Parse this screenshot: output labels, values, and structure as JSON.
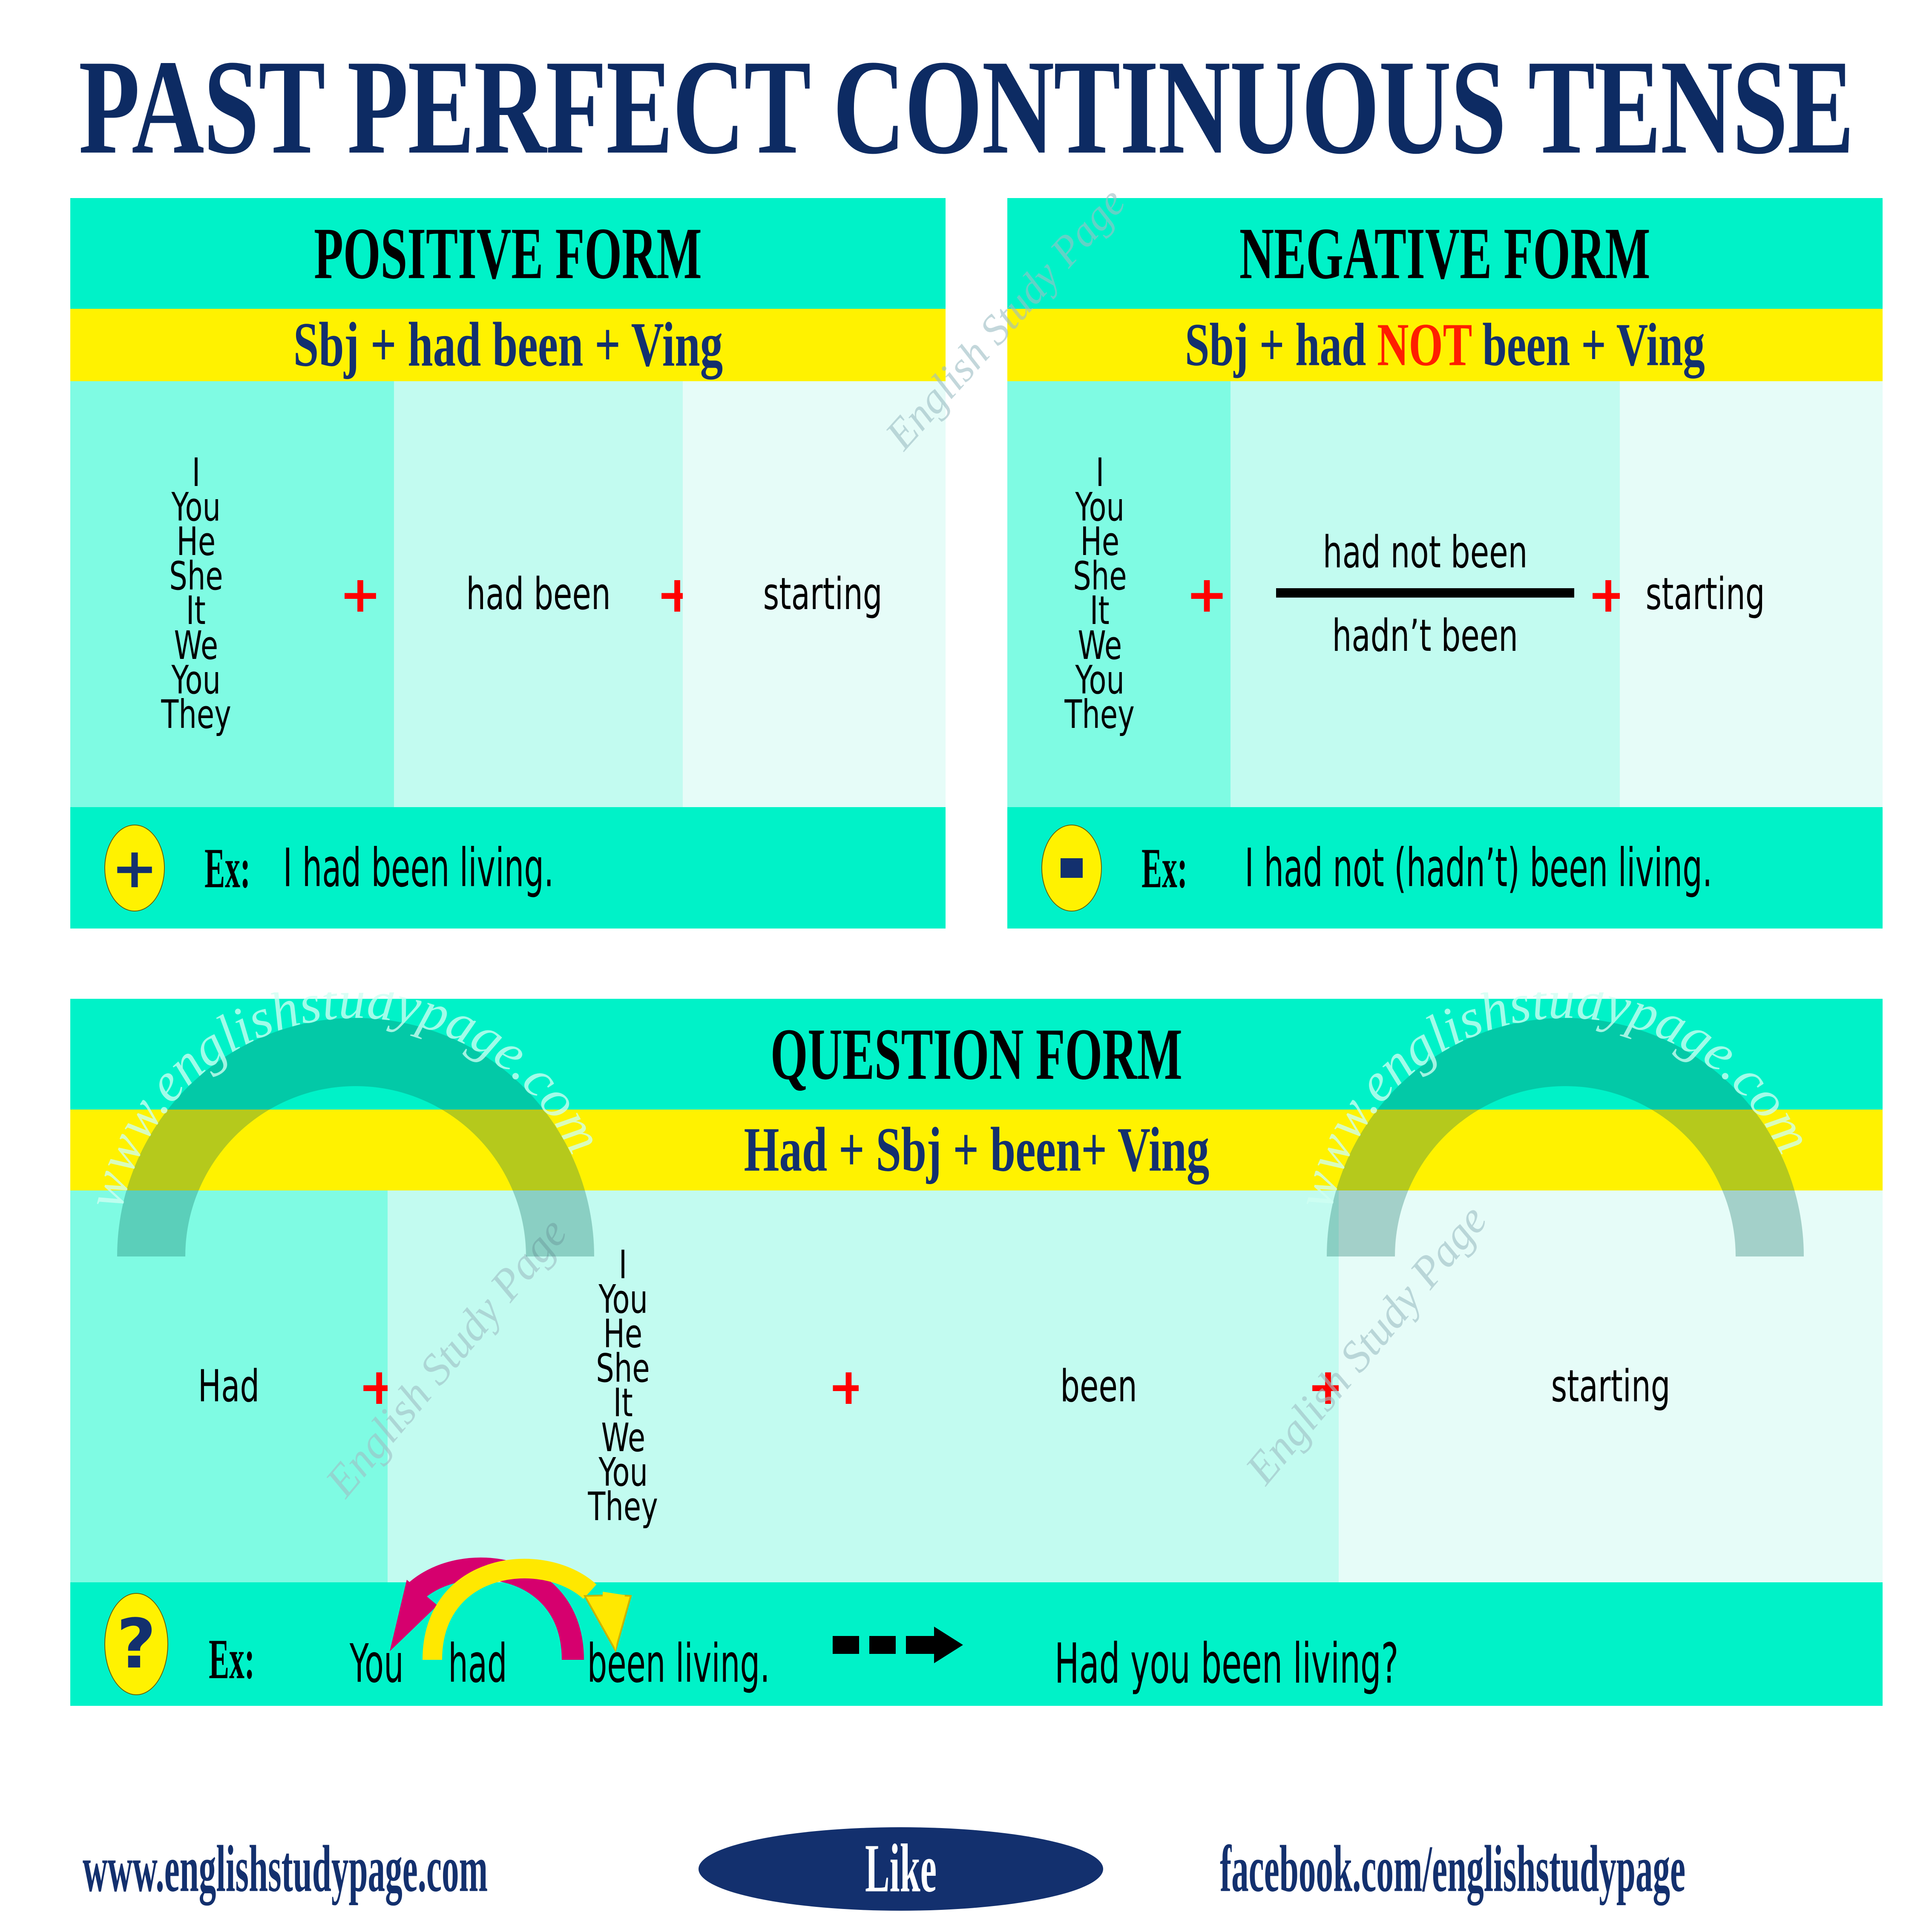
{
  "title": "PAST PERFECT CONTINUOUS TENSE",
  "colors": {
    "navy": "#13306e",
    "title_navy": "#0d2b63",
    "accent_turquoise": "#00f2c8",
    "tint_1": "#7ffbe3",
    "tint_2": "#c2fbf0",
    "tint_3": "#e6fcf8",
    "yellow": "#fff200",
    "red": "#ff0000",
    "pink_arrow": "#d6006e",
    "yellow_arrow": "#ffe800"
  },
  "pronouns": [
    "I",
    "You",
    "He",
    "She",
    "It",
    "We",
    "You",
    "They"
  ],
  "plus_sign": "+",
  "positive": {
    "heading": "POSITIVE FORM",
    "formula_prefix": "Sbj + had been + Ving",
    "col_aux": "had been",
    "col_verb": "starting",
    "example_badge": "plus-icon",
    "example_label": "Ex:",
    "example_text": "I had been living."
  },
  "negative": {
    "heading": "NEGATIVE FORM",
    "formula_a": "Sbj + had ",
    "formula_not": "NOT",
    "formula_b": " been + Ving",
    "col_long": "had not been",
    "col_short": "hadn’t been",
    "col_verb": "starting",
    "example_badge": "minus-icon",
    "example_label": "Ex:",
    "example_text": "I had not (hadn’t) been living."
  },
  "question": {
    "heading": "QUESTION FORM",
    "formula": "Had +  Sbj + been+ Ving",
    "col_had": "Had",
    "col_been": "been",
    "col_verb": "starting",
    "example_badge": "question-icon",
    "example_label": "Ex:",
    "source_you": "You",
    "source_had": "had",
    "source_rest": "been living.",
    "arrow_glyph": "dashed-arrow-icon",
    "result": "Had you been living?"
  },
  "watermarks": {
    "diagonal": "English Study Page",
    "arc": "www.englishstudypage.com"
  },
  "footer": {
    "website": "www.englishstudypage.com",
    "like_label": "Like",
    "facebook": "facebook.com/englishstudypage"
  }
}
